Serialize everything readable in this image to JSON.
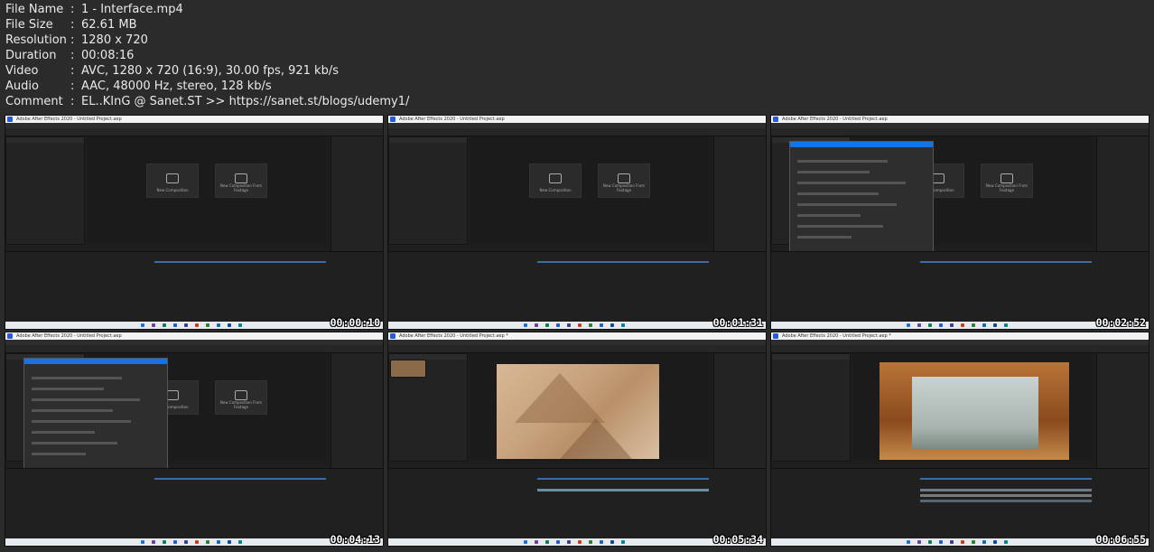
{
  "file_info": [
    {
      "key": "File Name",
      "value": "1 - Interface.mp4"
    },
    {
      "key": "File Size",
      "value": "62.61 MB"
    },
    {
      "key": "Resolution",
      "value": "1280 x 720"
    },
    {
      "key": "Duration",
      "value": "00:08:16"
    },
    {
      "key": "Video",
      "value": "AVC, 1280 x 720 (16:9), 30.00 fps, 921 kb/s"
    },
    {
      "key": "Audio",
      "value": "AAC, 48000 Hz, stereo, 128 kb/s"
    },
    {
      "key": "Comment",
      "value": "EL..KInG @ Sanet.ST >> https://sanet.st/blogs/udemy1/"
    }
  ],
  "separator": ":",
  "thumbnails": [
    {
      "timestamp": "00:00:10",
      "scene": "start",
      "window_title": "Adobe After Effects 2020 - Untitled Project.aep",
      "card1": "New Composition",
      "card2": "New Composition From Footage"
    },
    {
      "timestamp": "00:01:31",
      "scene": "start",
      "window_title": "Adobe After Effects 2020 - Untitled Project.aep",
      "card1": "New Composition",
      "card2": "New Composition From Footage"
    },
    {
      "timestamp": "00:02:52",
      "scene": "dialog-right",
      "window_title": "Adobe After Effects 2020 - Untitled Project.aep",
      "card1": "New Composition",
      "card2": "New Composition From Footage"
    },
    {
      "timestamp": "00:04:13",
      "scene": "dialog-left",
      "window_title": "Adobe After Effects 2020 - Untitled Project.aep",
      "card1": "New Composition",
      "card2": "New Composition From Footage"
    },
    {
      "timestamp": "00:05:34",
      "scene": "pyramid",
      "window_title": "Adobe After Effects 2020 - Untitled Project.aep *"
    },
    {
      "timestamp": "00:06:55",
      "scene": "swing",
      "window_title": "Adobe After Effects 2020 - Untitled Project.aep *"
    }
  ]
}
